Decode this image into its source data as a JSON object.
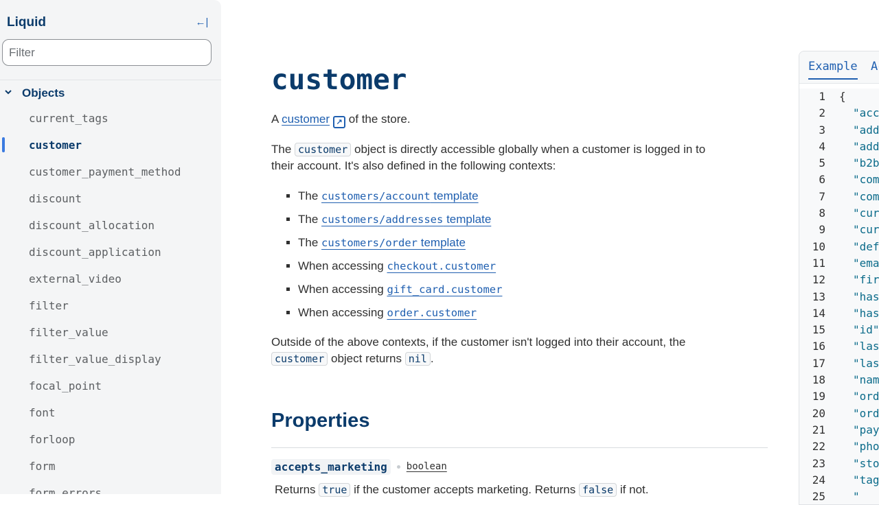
{
  "sidebar": {
    "title": "Liquid",
    "collapse_icon": "←|",
    "filter_placeholder": "Filter",
    "section": {
      "chevron": "⌄",
      "label": "Objects"
    },
    "items": [
      "current_tags",
      "customer",
      "customer_payment_method",
      "discount",
      "discount_allocation",
      "discount_application",
      "external_video",
      "filter",
      "filter_value",
      "filter_value_display",
      "focal_point",
      "font",
      "forloop",
      "form",
      "form_errors"
    ],
    "active_item": "customer"
  },
  "main": {
    "title": "customer",
    "intro": {
      "prefix": "A",
      "link": "customer",
      "suffix": "of the store."
    },
    "p2": {
      "t1": "The",
      "code": "customer",
      "t2": "object is directly accessible globally when a customer is logged in to",
      "t3": "their account. It's also defined in the following contexts:"
    },
    "contexts": [
      {
        "prefix": "The",
        "code": "customers/account",
        "rest": " template"
      },
      {
        "prefix": "The",
        "code": "customers/addresses",
        "rest": " template"
      },
      {
        "prefix": "The",
        "code": "customers/order",
        "rest": " template"
      },
      {
        "prefix": "When accessing",
        "code": "checkout.customer",
        "rest": ""
      },
      {
        "prefix": "When accessing",
        "code": "gift_card.customer",
        "rest": ""
      },
      {
        "prefix": "When accessing",
        "code": "order.customer",
        "rest": ""
      }
    ],
    "p3": {
      "t1": "Outside of the above contexts, if the customer isn't logged into their account, the",
      "code1": "customer",
      "t2": "object returns",
      "code2": "nil",
      "t3": "."
    },
    "properties_heading": "Properties",
    "property": {
      "name": "accepts_marketing",
      "type": "boolean",
      "desc_t1": "Returns",
      "desc_code1": "true",
      "desc_t2": "if the customer accepts marketing. Returns",
      "desc_code2": "false",
      "desc_t3": "if not."
    }
  },
  "panel": {
    "tabs": [
      "Example",
      "Ac"
    ],
    "lines": [
      {
        "n": "1",
        "c": "{"
      },
      {
        "n": "2",
        "c": "\"acc"
      },
      {
        "n": "3",
        "c": "\"add"
      },
      {
        "n": "4",
        "c": "\"add"
      },
      {
        "n": "5",
        "c": "\"b2b"
      },
      {
        "n": "6",
        "c": "\"com"
      },
      {
        "n": "7",
        "c": "\"com"
      },
      {
        "n": "8",
        "c": "\"cur"
      },
      {
        "n": "9",
        "c": "\"cur"
      },
      {
        "n": "10",
        "c": "\"def"
      },
      {
        "n": "11",
        "c": "\"ema"
      },
      {
        "n": "12",
        "c": "\"fir"
      },
      {
        "n": "13",
        "c": "\"has"
      },
      {
        "n": "14",
        "c": "\"has"
      },
      {
        "n": "15",
        "c": "\"id\""
      },
      {
        "n": "16",
        "c": "\"las"
      },
      {
        "n": "17",
        "c": "\"las"
      },
      {
        "n": "18",
        "c": "\"nam"
      },
      {
        "n": "19",
        "c": "\"ord"
      },
      {
        "n": "20",
        "c": "\"ord"
      },
      {
        "n": "21",
        "c": "\"pay"
      },
      {
        "n": "22",
        "c": "\"pho"
      },
      {
        "n": "23",
        "c": "\"sto"
      },
      {
        "n": "24",
        "c": "\"tag"
      },
      {
        "n": "25",
        "c": "\""
      }
    ]
  }
}
